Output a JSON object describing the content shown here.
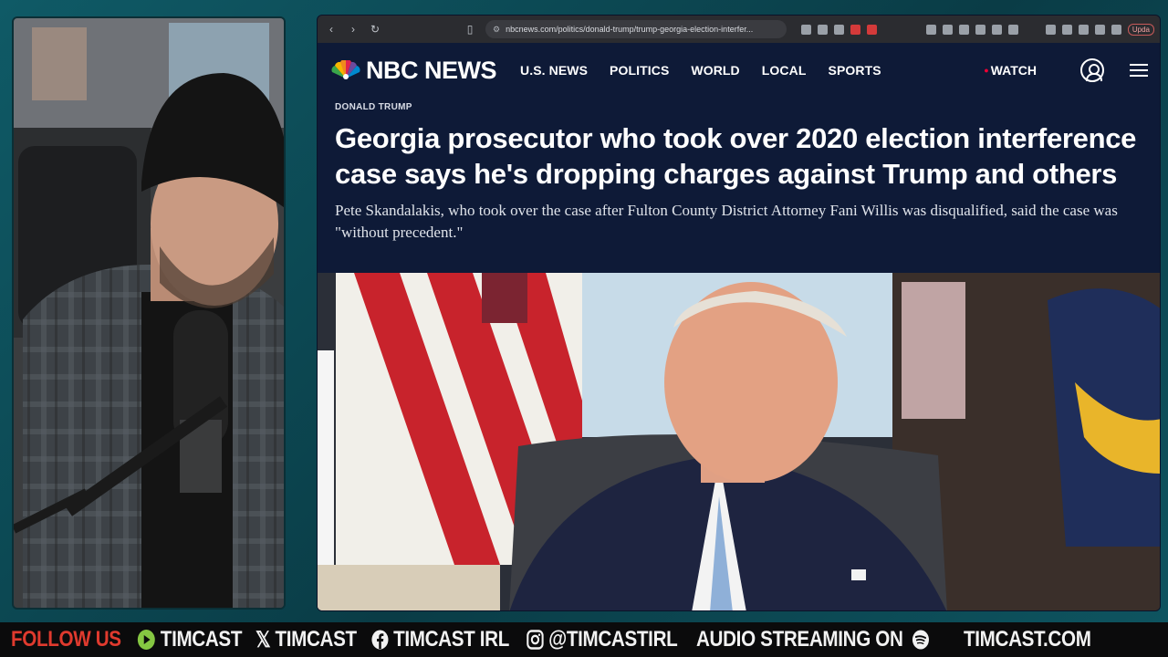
{
  "browser": {
    "url": "nbcnews.com/politics/donald-trump/trump-georgia-election-interfer...",
    "update_label": "Upda"
  },
  "site": {
    "brand": "NBC NEWS",
    "nav": [
      "U.S. NEWS",
      "POLITICS",
      "WORLD",
      "LOCAL",
      "SPORTS"
    ],
    "watch_label": "WATCH"
  },
  "article": {
    "kicker": "DONALD TRUMP",
    "headline": "Georgia prosecutor who took over 2020 election interference case says he's dropping charges against Trump and others",
    "dek": "Pete Skandalakis, who took over the case after Fulton County District Attorney Fani Willis was disqualified, said the case was \"without precedent.\""
  },
  "ticker": {
    "follow": "FOLLOW US",
    "rumble": "TIMCAST",
    "x": "TIMCAST",
    "facebook": "TIMCAST IRL",
    "instagram": "@TIMCASTIRL",
    "audio": "AUDIO STREAMING ON",
    "site": "TIMCAST.COM"
  },
  "colors": {
    "nbc_navy": "#0e1a37",
    "follow_red": "#e03a2e",
    "rumble_green": "#85c742"
  }
}
